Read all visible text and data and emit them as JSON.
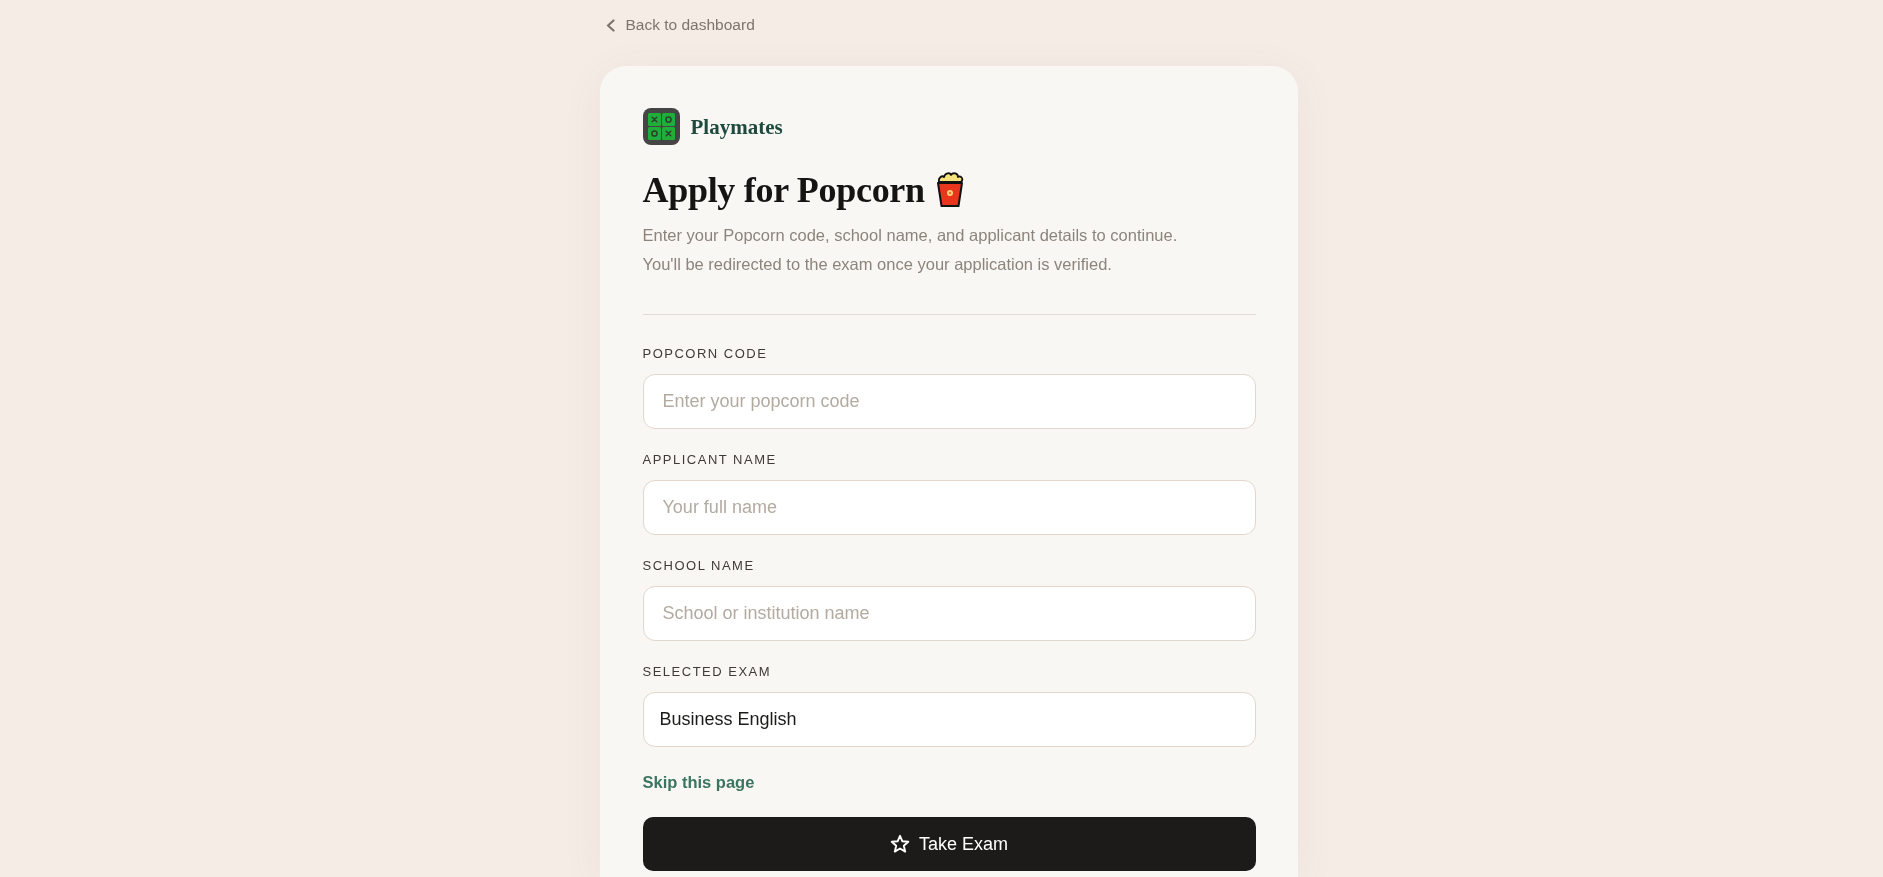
{
  "back_link": {
    "label": "Back to dashboard"
  },
  "brand": {
    "name": "Playmates"
  },
  "heading": {
    "title": "Apply for Popcorn",
    "description": [
      "Enter your Popcorn code, school name, and applicant details to continue.",
      "You'll be redirected to the exam once your application is verified."
    ]
  },
  "fields": [
    {
      "label": "POPCORN CODE",
      "placeholder": "Enter your popcorn code"
    },
    {
      "label": "APPLICANT NAME",
      "placeholder": "Your full name"
    },
    {
      "label": "SCHOOL NAME",
      "placeholder": "School or institution name"
    },
    {
      "label": "SELECTED EXAM",
      "value": "Business English"
    }
  ],
  "skip_link": {
    "label": "Skip this page"
  },
  "submit_button": {
    "label": "Take Exam"
  }
}
